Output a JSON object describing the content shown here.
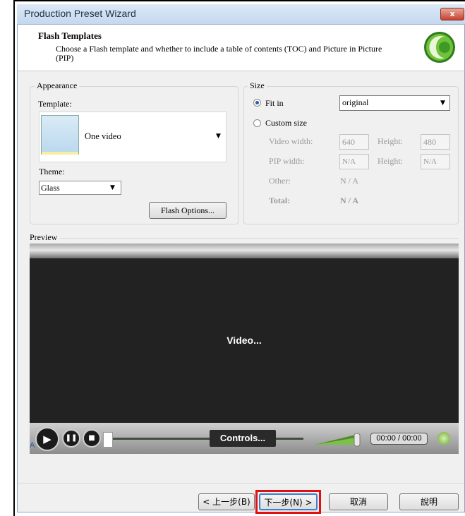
{
  "window": {
    "title": "Production Preset Wizard",
    "close_symbol": "x"
  },
  "header": {
    "title": "Flash Templates",
    "description": "Choose a Flash template and whether to include a table of contents (TOC) and Picture in Picture (PIP)"
  },
  "appearance": {
    "legend": "Appearance",
    "template_label": "Template:",
    "template_value": "One video",
    "theme_label": "Theme:",
    "theme_value": "Glass",
    "flash_options_label": "Flash Options..."
  },
  "size": {
    "legend": "Size",
    "fit_in_label": "Fit in",
    "fit_in_value": "original",
    "custom_size_label": "Custom size",
    "video_width_label": "Video width:",
    "video_width_value": "640",
    "video_height_label": "Height:",
    "video_height_value": "480",
    "pip_width_label": "PIP width:",
    "pip_width_value": "N/A",
    "pip_height_label": "Height:",
    "pip_height_value": "N/A",
    "other_label": "Other:",
    "other_value": "N / A",
    "total_label": "Total:",
    "total_value": "N / A",
    "selected": "fit_in"
  },
  "preview": {
    "label": "Preview",
    "video_label": "Video...",
    "controls_label": "Controls...",
    "time": "00:00 / 00:00",
    "small_mark": "A"
  },
  "footer": {
    "back_label": "< 上一步(B)",
    "next_label": "下一步(N) >",
    "cancel_label": "取消",
    "help_label": "說明"
  },
  "colors": {
    "highlight": "#e01010",
    "video_bg": "#222222",
    "accent": "#3a7fd0"
  }
}
